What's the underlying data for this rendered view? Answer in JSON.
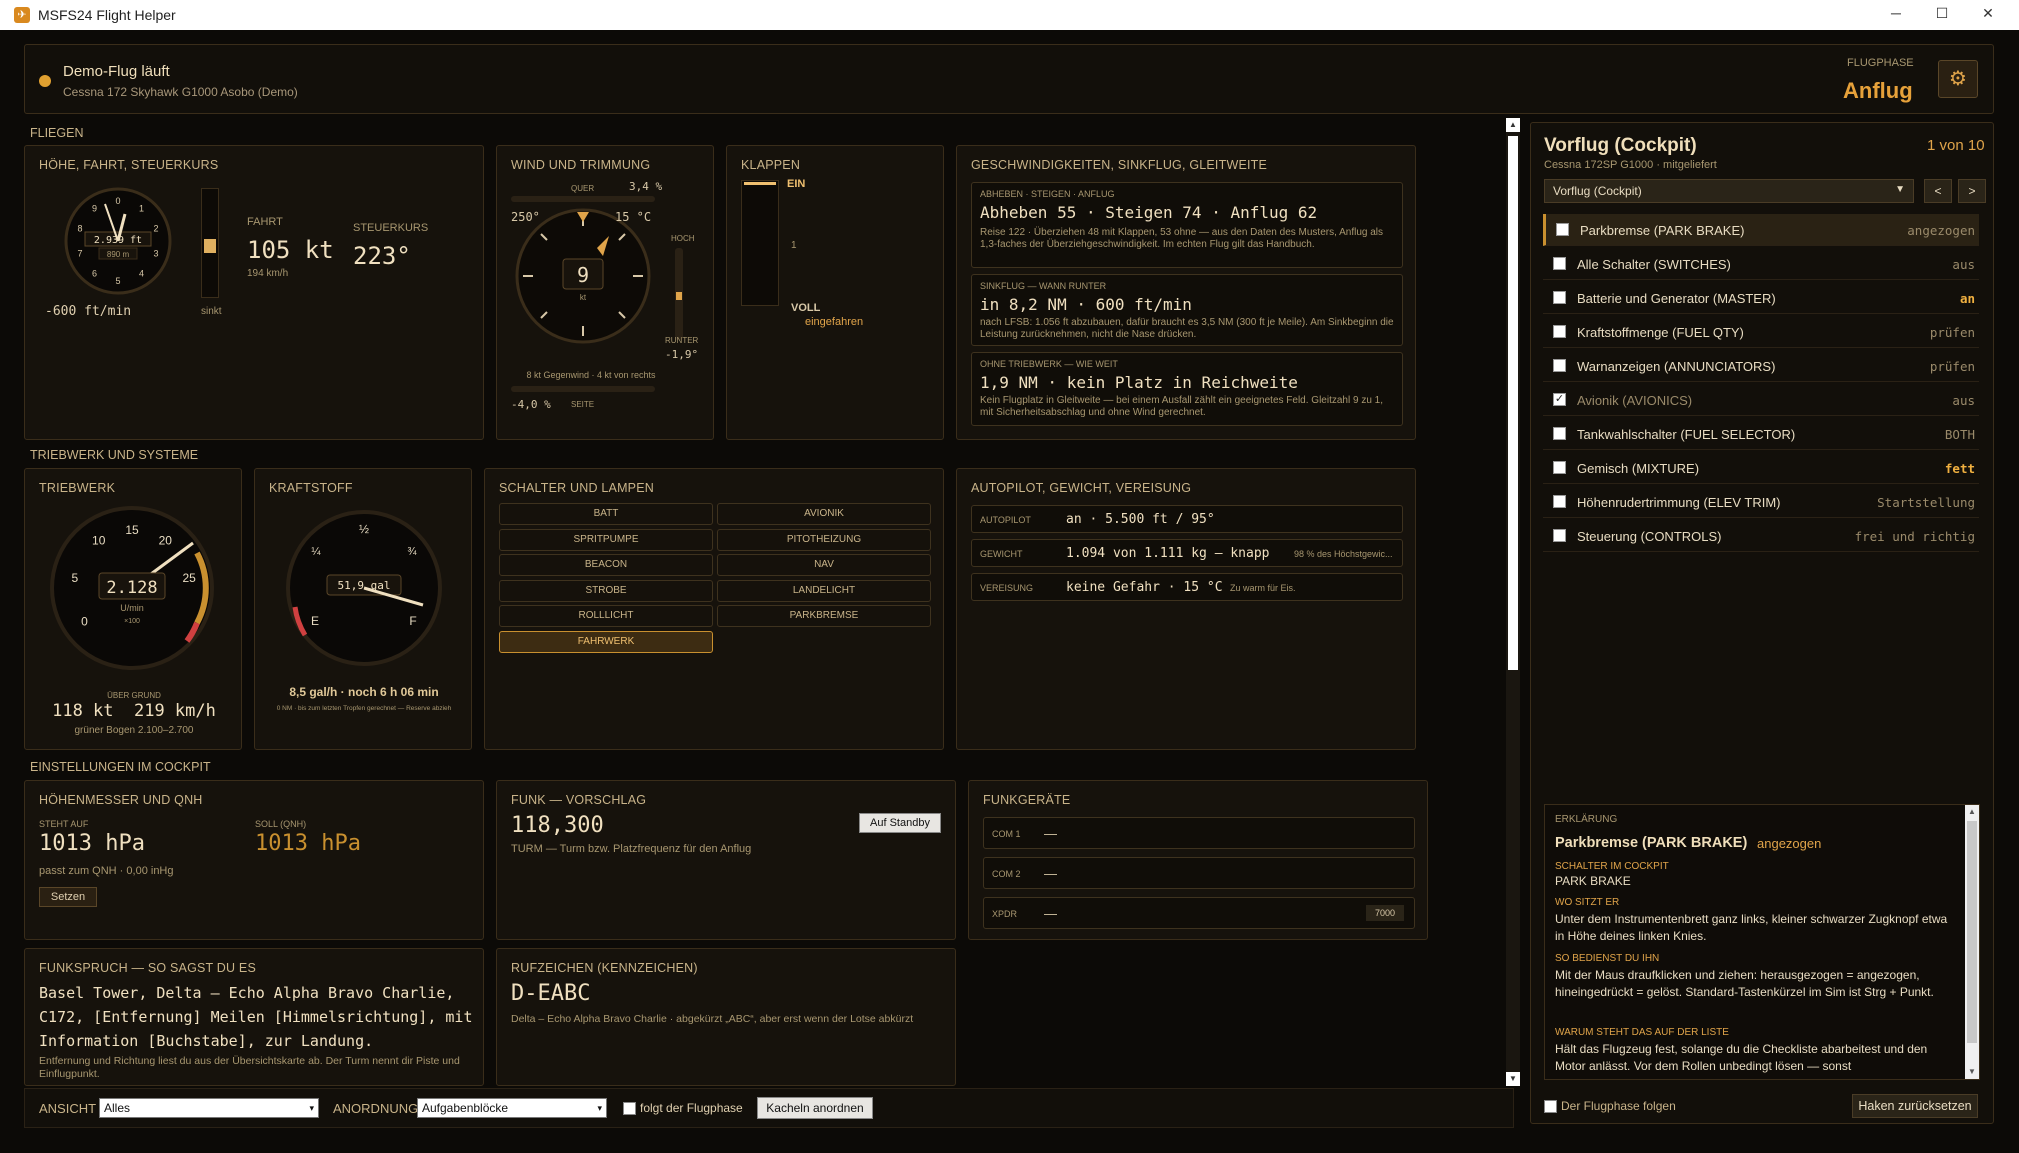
{
  "window": {
    "title": "MSFS24 Flight Helper",
    "icon": "plane-icon"
  },
  "status": {
    "title": "Demo-Flug läuft",
    "subtitle": "Cessna 172 Skyhawk G1000 Asobo (Demo)",
    "phase_label": "FLUGPHASE",
    "phase": "Anflug"
  },
  "sections": {
    "fly": "FLIEGEN",
    "engine": "TRIEBWERK UND SYSTEME",
    "cockpit": "EINSTELLUNGEN IM COCKPIT"
  },
  "alt": {
    "title": "HÖHE, FAHRT, STEUERKURS",
    "alt_value": "2.939 ft",
    "alt_m": "890 m",
    "vs": "-600 ft/min",
    "vs_label": "sinkt",
    "speed_label": "FAHRT",
    "speed": "105 kt",
    "speed_kmh": "194 km/h",
    "hdg_label": "STEUERKURS",
    "hdg": "223°",
    "dial": [
      "0",
      "1",
      "2",
      "3",
      "4",
      "5",
      "6",
      "7",
      "8",
      "9"
    ]
  },
  "wind": {
    "title": "WIND UND TRIMMUNG",
    "quer_label": "QUER",
    "quer": "3,4 %",
    "dir": "250°",
    "temp": "15 °C",
    "speed": "9",
    "unit": "kt",
    "hoch": "HOCH",
    "runter": "RUNTER",
    "elev": "-1,9°",
    "desc": "8 kt Gegenwind · 4 kt von rechts",
    "side": "-4,0 %",
    "side_label": "SEITE"
  },
  "flaps": {
    "title": "KLAPPEN",
    "ein": "EIN",
    "one": "1",
    "voll": "VOLL",
    "state": "eingefahren"
  },
  "speeds": {
    "title": "GESCHWINDIGKEITEN, SINKFLUG, GLEITWEITE",
    "b1_label": "ABHEBEN · STEIGEN · ANFLUG",
    "b1_value": "Abheben 55 · Steigen 74 · Anflug 62",
    "b1_text": "Reise 122 · Überziehen 48 mit Klappen, 53 ohne — aus den Daten des Musters, Anflug als 1,3-faches der Überziehgeschwindigkeit. Im echten Flug gilt das Handbuch.",
    "b2_label": "SINKFLUG — WANN RUNTER",
    "b2_value": "in 8,2 NM · 600 ft/min",
    "b2_text": "nach LFSB: 1.056 ft abzubauen, dafür braucht es 3,5 NM (300 ft je Meile). Am Sinkbeginn die Leistung zurücknehmen, nicht die Nase drücken.",
    "b3_label": "OHNE TRIEBWERK — WIE WEIT",
    "b3_value": "1,9 NM · kein Platz in Reichweite",
    "b3_text": "Kein Flugplatz in Gleitweite — bei einem Ausfall zählt ein geeignetes Feld. Gleitzahl 9 zu 1, mit Sicherheitsabschlag und ohne Wind gerechnet."
  },
  "engine": {
    "title": "TRIEBWERK",
    "rpm": "2.128",
    "unit": "U/min",
    "mult": "×100",
    "ticks": [
      "0",
      "5",
      "10",
      "15",
      "20",
      "25"
    ],
    "gs_label": "ÜBER GRUND",
    "gs": "118 kt  219 km/h",
    "arc": "grüner Bogen 2.100–2.700"
  },
  "fuel": {
    "title": "KRAFTSTOFF",
    "qty": "51,9 gal",
    "half": "½",
    "q1": "¼",
    "q3": "¾",
    "e": "E",
    "f": "F",
    "flow": "8,5 gal/h · noch 6 h 06 min",
    "note": "0 NM · bis zum letzten Tropfen gerechnet — Reserve abzieh"
  },
  "switches": {
    "title": "SCHALTER UND LAMPEN",
    "items": [
      "BATT",
      "AVIONIK",
      "SPRITPUMPE",
      "PITOTHEIZUNG",
      "BEACON",
      "NAV",
      "STROBE",
      "LANDELICHT",
      "ROLLLICHT",
      "PARKBREMSE",
      "FAHRWERK"
    ]
  },
  "ap": {
    "title": "AUTOPILOT, GEWICHT, VEREISUNG",
    "r1_label": "AUTOPILOT",
    "r1_value": "an · 5.500 ft / 95°",
    "r2_label": "GEWICHT",
    "r2_value": "1.094 von 1.111 kg — knapp",
    "r2_note": "98 % des Höchstgewic...",
    "r3_label": "VEREISUNG",
    "r3_value": "keine Gefahr · 15 °C",
    "r3_note": "Zu warm für Eis."
  },
  "altimeter": {
    "title": "HÖHENMESSER UND QNH",
    "is_label": "STEHT AUF",
    "is_value": "1013 hPa",
    "set_label": "SOLL (QNH)",
    "set_value": "1013 hPa",
    "note": "passt zum QNH · 0,00 inHg",
    "button": "Setzen"
  },
  "radio": {
    "title": "FUNK — VORSCHLAG",
    "freq": "118,300",
    "desc": "TURM — Turm bzw. Platzfrequenz für den Anflug",
    "button": "Auf Standby"
  },
  "radios": {
    "title": "FUNKGERÄTE",
    "com1_label": "COM 1",
    "com1": "—",
    "com2_label": "COM 2",
    "com2": "—",
    "xpdr_label": "XPDR",
    "xpdr": "—",
    "xpdr_code": "7000"
  },
  "callout": {
    "title": "FUNKSPRUCH — SO SAGST DU ES",
    "text": "Basel Tower, Delta – Echo Alpha Bravo Charlie, C172, [Entfernung] Meilen [Himmelsrichtung], mit Information [Buchstabe], zur Landung.",
    "note": "Entfernung und Richtung liest du aus der Übersichtskarte ab. Der Turm nennt dir Piste und Einflugpunkt."
  },
  "callsign": {
    "title": "RUFZEICHEN (KENNZEICHEN)",
    "value": "D-EABC",
    "note": "Delta – Echo Alpha Bravo Charlie · abgekürzt „ABC“, aber erst wenn der Lotse abkürzt"
  },
  "bottom": {
    "view_label": "ANSICHT",
    "view": "Alles",
    "order_label": "ANORDNUNG",
    "order": "Aufgabenblöcke",
    "follow": "folgt der Flugphase",
    "arrange": "Kacheln anordnen"
  },
  "checklist": {
    "title": "Vorflug (Cockpit)",
    "count": "1 von 10",
    "subtitle": "Cessna 172SP G1000 · mitgeliefert",
    "select": "Vorflug (Cockpit)",
    "prev": "<",
    "next": ">",
    "items": [
      {
        "name": "Parkbremse (PARK BRAKE)",
        "value": "angezogen",
        "checked": false
      },
      {
        "name": "Alle Schalter (SWITCHES)",
        "value": "aus",
        "checked": false
      },
      {
        "name": "Batterie und Generator (MASTER)",
        "value": "an",
        "checked": false
      },
      {
        "name": "Kraftstoffmenge (FUEL QTY)",
        "value": "prüfen",
        "checked": false
      },
      {
        "name": "Warnanzeigen (ANNUNCIATORS)",
        "value": "prüfen",
        "checked": false
      },
      {
        "name": "Avionik (AVIONICS)",
        "value": "aus",
        "checked": true
      },
      {
        "name": "Tankwahlschalter (FUEL SELECTOR)",
        "value": "BOTH",
        "checked": false
      },
      {
        "name": "Gemisch (MIXTURE)",
        "value": "fett",
        "checked": false
      },
      {
        "name": "Höhenrudertrimmung (ELEV TRIM)",
        "value": "Startstellung",
        "checked": false
      },
      {
        "name": "Steuerung (CONTROLS)",
        "value": "frei und richtig",
        "checked": false
      }
    ],
    "exp_label": "ERKLÄRUNG",
    "exp_title": "Parkbremse (PARK BRAKE)",
    "exp_value": "angezogen",
    "h1": "SCHALTER IM COCKPIT",
    "t1": "PARK BRAKE",
    "h2": "WO SITZT ER",
    "t2": "Unter dem Instrumentenbrett ganz links, kleiner schwarzer Zugknopf etwa in Höhe deines linken Knies.",
    "h3": "SO BEDIENST DU IHN",
    "t3": "Mit der Maus draufklicken und ziehen: herausgezogen = angezogen, hineingedrückt = gelöst. Standard-Tastenkürzel im Sim ist Strg + Punkt.",
    "h4": "WARUM STEHT DAS AUF DER LISTE",
    "t4": "Hält das Flugzeug fest, solange du die Checkliste abarbeitest und den Motor anlässt. Vor dem Rollen unbedingt lösen — sonst",
    "follow": "Der Flugphase folgen",
    "reset": "Haken zurücksetzen"
  }
}
